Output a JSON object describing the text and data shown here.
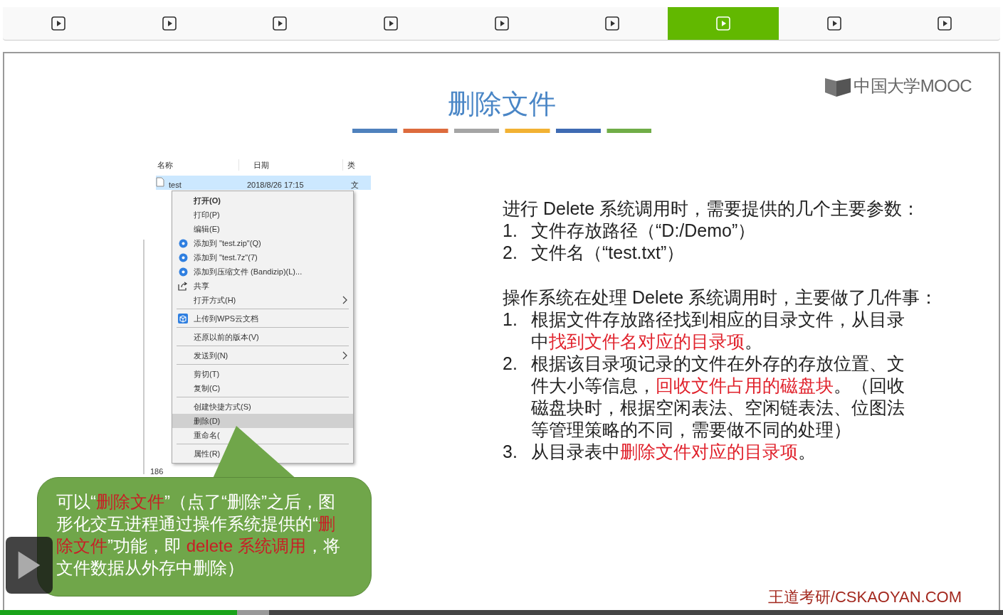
{
  "segments": [
    {
      "selected": false
    },
    {
      "selected": false
    },
    {
      "selected": false
    },
    {
      "selected": false
    },
    {
      "selected": false
    },
    {
      "selected": false
    },
    {
      "selected": true
    },
    {
      "selected": false
    },
    {
      "selected": false
    }
  ],
  "slide": {
    "title": "删除文件",
    "logo": "中国大学MOOC",
    "explorer": {
      "columns": [
        "名称",
        "日期",
        "类"
      ],
      "row": {
        "name": "test",
        "date": "2018/8/26 17:15",
        "type": "文",
        "selected": true
      },
      "status": "186"
    },
    "context_menu": [
      [
        {
          "label": "打开(O)",
          "kind": "default",
          "submenu": false,
          "selected": false
        },
        {
          "label": "打印(P)",
          "kind": "plain",
          "submenu": false,
          "selected": false
        },
        {
          "label": "编辑(E)",
          "kind": "plain",
          "submenu": false,
          "selected": false
        },
        {
          "label": "添加到 \"test.zip\"(Q)",
          "kind": "zip",
          "submenu": false,
          "selected": false
        },
        {
          "label": "添加到 \"test.7z\"(7)",
          "kind": "zip",
          "submenu": false,
          "selected": false
        },
        {
          "label": "添加到压缩文件 (Bandizip)(L)...",
          "kind": "zip",
          "submenu": false,
          "selected": false
        },
        {
          "label": "共享",
          "kind": "share",
          "submenu": false,
          "selected": false
        },
        {
          "label": "打开方式(H)",
          "kind": "plain",
          "submenu": true,
          "selected": false
        }
      ],
      [
        {
          "label": "上传到WPS云文档",
          "kind": "cloud",
          "submenu": false,
          "selected": false
        }
      ],
      [
        {
          "label": "还原以前的版本(V)",
          "kind": "plain",
          "submenu": false,
          "selected": false
        }
      ],
      [
        {
          "label": "发送到(N)",
          "kind": "plain",
          "submenu": true,
          "selected": false
        }
      ],
      [
        {
          "label": "剪切(T)",
          "kind": "plain",
          "submenu": false,
          "selected": false
        },
        {
          "label": "复制(C)",
          "kind": "plain",
          "submenu": false,
          "selected": false
        }
      ],
      [
        {
          "label": "创建快捷方式(S)",
          "kind": "plain",
          "submenu": false,
          "selected": false
        },
        {
          "label": "删除(D)",
          "kind": "plain",
          "submenu": false,
          "selected": true
        },
        {
          "label": "重命名(",
          "kind": "plain",
          "submenu": false,
          "selected": false
        }
      ],
      [
        {
          "label": "属性(R)",
          "kind": "plain",
          "submenu": false,
          "selected": false
        }
      ]
    ],
    "blocks": [
      {
        "kind": "text",
        "segments": [
          {
            "text": "进行 Delete 系统调用时，需要提供的几个主要参数：",
            "highlight": false
          }
        ]
      },
      {
        "kind": "list",
        "items": [
          {
            "number": "1.",
            "segments": [
              {
                "text": "文件存放路径（“D:/Demo”）",
                "highlight": false
              }
            ]
          },
          {
            "number": "2.",
            "segments": [
              {
                "text": "文件名（“test.txt”）",
                "highlight": false
              }
            ]
          }
        ]
      },
      {
        "kind": "text",
        "segments": [
          {
            "text": "操作系统在处理 Delete 系统调用时，主要做了几件事：",
            "highlight": false
          }
        ]
      },
      {
        "kind": "list",
        "items": [
          {
            "number": "1.",
            "segments": [
              {
                "text": "根据文件存放路径找到相应的目录文件，从目录中",
                "highlight": false
              },
              {
                "text": "找到文件名对应的目录项",
                "highlight": true
              },
              {
                "text": "。",
                "highlight": false
              }
            ]
          },
          {
            "number": "2.",
            "segments": [
              {
                "text": "根据该目录项记录的文件在外存的存放位置、文件大小等信息，",
                "highlight": false
              },
              {
                "text": "回收文件占用的磁盘块",
                "highlight": true
              },
              {
                "text": "。（回收磁盘块时，根据空闲表法、空闲链表法、位图法等管理策略的不同，需要做不同的处理）",
                "highlight": false
              }
            ]
          },
          {
            "number": "3.",
            "segments": [
              {
                "text": "从目录表中",
                "highlight": false
              },
              {
                "text": "删除文件对应的目录项",
                "highlight": true
              },
              {
                "text": "。",
                "highlight": false
              }
            ]
          }
        ]
      }
    ],
    "callout": [
      {
        "text": "可以“",
        "highlight": false
      },
      {
        "text": "删除文件",
        "highlight": true
      },
      {
        "text": "”（点了“删除”之后，图形化交互进程通过操作系统提供的“",
        "highlight": false
      },
      {
        "text": "删除文件",
        "highlight": true
      },
      {
        "text": "”功能，即 ",
        "highlight": false
      },
      {
        "text": "delete 系统调用",
        "highlight": true
      },
      {
        "text": "，将文件数据从外存中删除）",
        "highlight": false
      }
    ],
    "footer": "王道考研/CSKAOYAN.COM"
  },
  "player": {
    "progress": {
      "level": 0.236
    },
    "buffered": {
      "level": 0.268
    }
  }
}
